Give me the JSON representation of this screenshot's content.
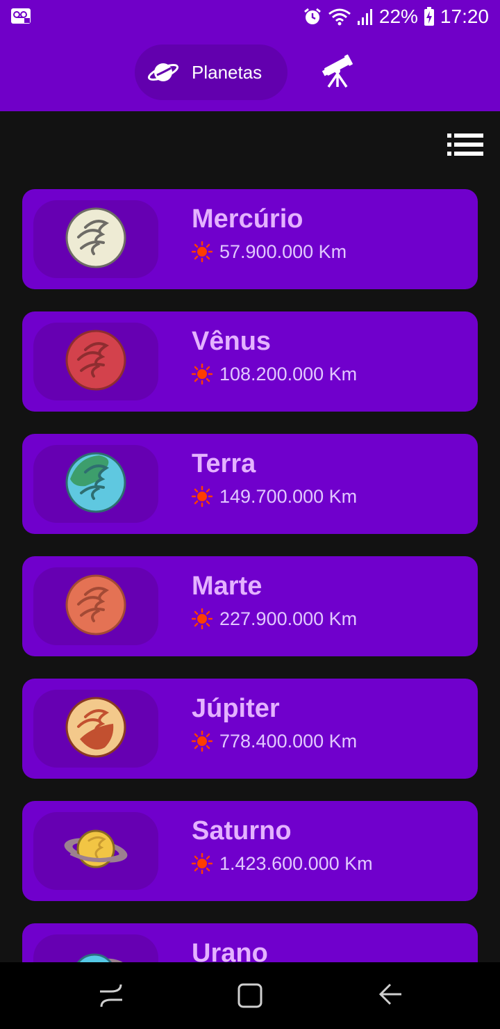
{
  "status_bar": {
    "battery": "22%",
    "time": "17:20",
    "icons": [
      "voicemail-icon",
      "alarm-icon",
      "wifi-icon",
      "signal-icon",
      "battery-charging-icon"
    ]
  },
  "header": {
    "tabs": [
      {
        "label": "Planetas",
        "icon": "planet-icon",
        "selected": true
      },
      {
        "label": "",
        "icon": "telescope-icon",
        "selected": false
      }
    ]
  },
  "toolbar": {
    "view_toggle_icon": "list-view-icon"
  },
  "planets": [
    {
      "name": "Mercúrio",
      "distance": "57.900.000 Km",
      "icon": "mercury-icon",
      "colors": [
        "#EEEBD4",
        "#6E6C66"
      ]
    },
    {
      "name": "Vênus",
      "distance": "108.200.000 Km",
      "icon": "venus-icon",
      "colors": [
        "#D3424C",
        "#8E2D30"
      ]
    },
    {
      "name": "Terra",
      "distance": "149.700.000 Km",
      "icon": "earth-icon",
      "colors": [
        "#5FC8E0",
        "#3D9E6C"
      ]
    },
    {
      "name": "Marte",
      "distance": "227.900.000 Km",
      "icon": "mars-icon",
      "colors": [
        "#E47254",
        "#A34A35"
      ]
    },
    {
      "name": "Júpiter",
      "distance": "778.400.000 Km",
      "icon": "jupiter-icon",
      "colors": [
        "#F3C98B",
        "#C25030"
      ]
    },
    {
      "name": "Saturno",
      "distance": "1.423.600.000 Km",
      "icon": "saturn-icon",
      "colors": [
        "#F2C544",
        "#9C8090"
      ]
    },
    {
      "name": "Urano",
      "distance": "",
      "icon": "uranus-icon",
      "colors": [
        "#55C9E6",
        "#9C8090"
      ]
    }
  ],
  "nav_bar": {
    "buttons": [
      "recent-apps-icon",
      "home-icon",
      "back-icon"
    ]
  },
  "colors": {
    "accent": "#7000C8",
    "card": "#7000CC",
    "thumb": "#6600B2",
    "name_text": "#E4B2FF",
    "sun": "#FF3D00",
    "background": "#121212"
  }
}
